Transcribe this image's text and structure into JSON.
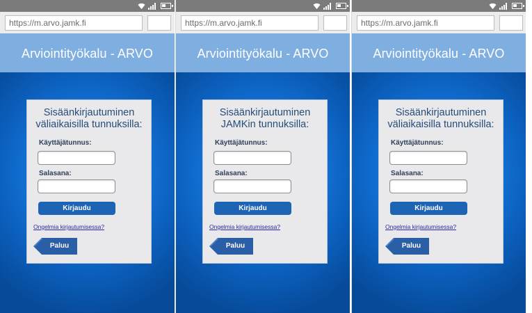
{
  "mockups": [
    {
      "url": "https://m.arvo.jamk.fi",
      "header_title": "Arviointityökalu - ARVO",
      "card_title_line1": "Sisäänkirjautuminen",
      "card_title_line2": "väliaikaisilla tunnuksilla:",
      "username_label": "Käyttäjätunnus:",
      "password_label": "Salasana:",
      "login_button": "Kirjaudu",
      "help_link": "Ongelmia kirjautumisessa?",
      "back_button": "Paluu"
    },
    {
      "url": "https://m.arvo.jamk.fi",
      "header_title": "Arviointityökalu - ARVO",
      "card_title_line1": "Sisäänkirjautuminen",
      "card_title_line2": "JAMKin tunnuksilla:",
      "username_label": "Käyttäjätunnus:",
      "password_label": "Salasana:",
      "login_button": "Kirjaudu",
      "help_link": "Ongelmia kirjautumisessa?",
      "back_button": "Paluu"
    },
    {
      "url": "https://m.arvo.jamk.fi",
      "header_title": "Arviointityökalu - ARVO",
      "card_title_line1": "Sisäänkirjautuminen",
      "card_title_line2": "väliaikaisilla tunnuksilla:",
      "username_label": "Käyttäjätunnus:",
      "password_label": "Salasana:",
      "login_button": "Kirjaudu",
      "help_link": "Ongelmia kirjautumisessa?",
      "back_button": "Paluu"
    }
  ],
  "icons": {
    "status_bar": [
      "wifi-icon",
      "signal-icon",
      "battery-icon"
    ],
    "back_button": "back-arrow-icon"
  },
  "colors": {
    "status_bar": "#7b7b7b",
    "url_bar_background": "#ececec",
    "app_header": "#7faee0",
    "content_background": "#1476dc",
    "card_background": "#e9e9ec",
    "card_title": "#244d78",
    "login_button": "#1e64b4",
    "back_button": "#2a5fa8",
    "help_link": "#2a2aa0"
  }
}
